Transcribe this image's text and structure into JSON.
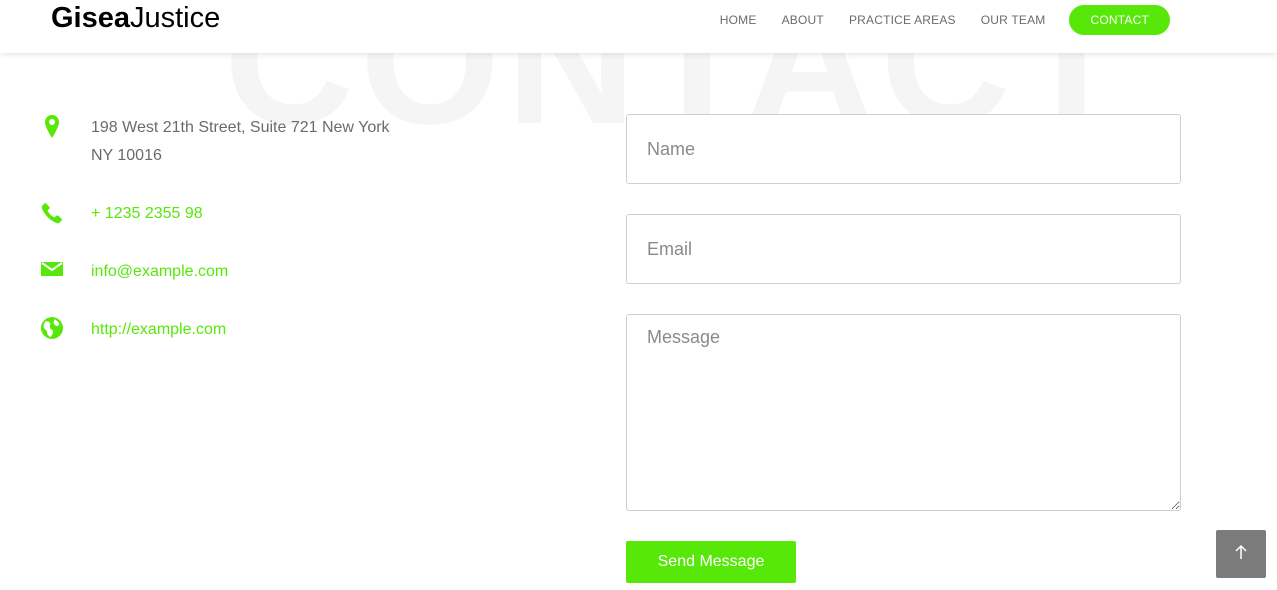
{
  "background_word": "CONTACT",
  "brand": {
    "bold": "Gisea",
    "regular": "Justice"
  },
  "nav": {
    "items": [
      {
        "label": "HOME"
      },
      {
        "label": "ABOUT"
      },
      {
        "label": "PRACTICE AREAS"
      },
      {
        "label": "OUR TEAM"
      },
      {
        "label": "CONTACT",
        "active": true
      }
    ]
  },
  "contact": {
    "address": "198 West 21th Street, Suite 721 New York NY 10016",
    "phone": "+ 1235 2355 98",
    "email": "info@example.com",
    "website": "http://example.com"
  },
  "form": {
    "name_placeholder": "Name",
    "email_placeholder": "Email",
    "message_placeholder": "Message",
    "submit_label": "Send Message"
  },
  "icons": {
    "address": "map-marker-icon",
    "phone": "phone-icon",
    "email": "envelope-icon",
    "website": "globe-icon",
    "back_to_top": "arrow-up-icon"
  },
  "colors": {
    "accent": "#57e80a",
    "text": "#6b6b6b",
    "back_to_top_bg": "#7b7b7b"
  }
}
